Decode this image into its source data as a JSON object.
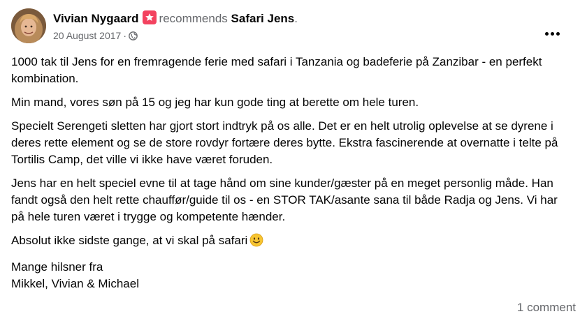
{
  "post": {
    "author": "Vivian Nygaard",
    "verb": "recommends",
    "page_name": "Safari Jens",
    "period": ".",
    "date": "20 August 2017",
    "separator": "·",
    "paragraphs": [
      "1000 tak til Jens for en fremragende ferie med safari i Tanzania og badeferie på Zanzibar - en perfekt kombination.",
      "Min mand, vores søn på 15 og jeg har kun gode ting at berette om hele turen.",
      "Specielt Serengeti sletten har gjort stort indtryk på os alle. Det er en helt utrolig oplevelse at se dyrene i deres rette element og se de store rovdyr fortære deres bytte. Ekstra fascinerende at overnatte i telte på Tortilis Camp, det ville vi ikke have været foruden.",
      "Jens har en helt speciel evne til at tage hånd om sine kunder/gæster på en meget personlig måde. Han fandt også den helt rette chauffør/guide til os - en STOR TAK/asante sana til både Radja og Jens. Vi har på hele turen været i trygge og kompetente hænder.",
      "Absolut ikke sidste gange, at vi skal på safari"
    ],
    "signoff": [
      "Mange hilsner fra",
      "Mikkel, Vivian & Michael"
    ],
    "comments_label": "1 comment"
  },
  "icons": {
    "recommend_badge": "star-badge-icon",
    "audience": "globe-icon",
    "more": "more-options-icon",
    "smile": "smiling-face-emoji"
  },
  "colors": {
    "badge": "#f3425f",
    "secondary_text": "#65676b",
    "primary_text": "#050505"
  }
}
